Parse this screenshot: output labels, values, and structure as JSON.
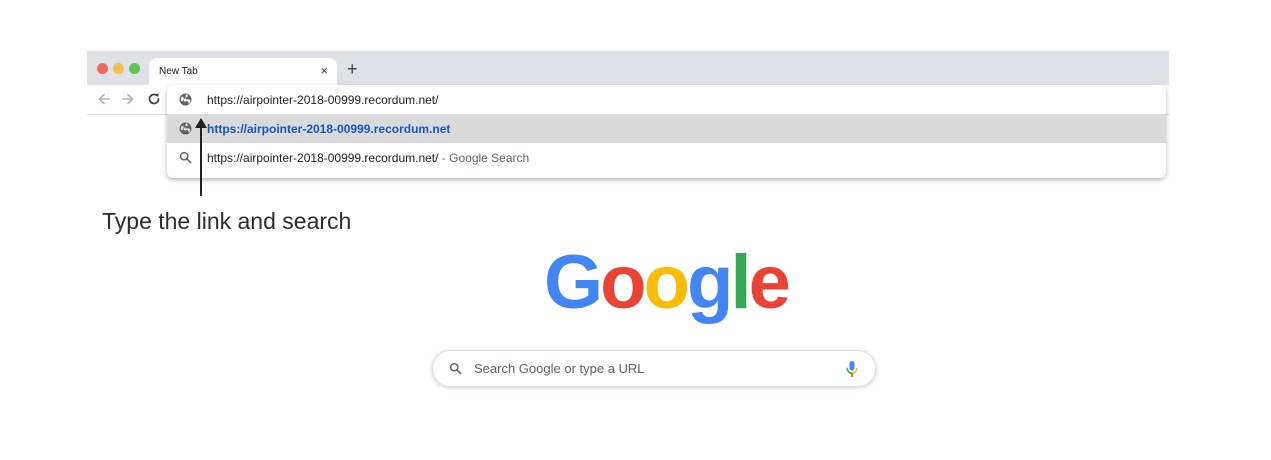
{
  "browser": {
    "tab": {
      "title": "New Tab",
      "close_glyph": "×"
    },
    "new_tab_glyph": "+",
    "nav_icons": [
      "back-arrow-icon",
      "forward-arrow-icon",
      "reload-icon"
    ]
  },
  "omnibox": {
    "value": "https://airpointer-2018-00999.recordum.net/",
    "icon": "globe-icon",
    "suggestions": [
      {
        "icon": "globe-icon",
        "text": "https://airpointer-2018-00999.recordum.net",
        "suffix": "",
        "highlighted": true
      },
      {
        "icon": "search-icon",
        "text": "https://airpointer-2018-00999.recordum.net/",
        "suffix": " - Google Search",
        "highlighted": false
      }
    ]
  },
  "annotation": {
    "text": "Type the link and search"
  },
  "new_tab_page": {
    "logo_letters": [
      "G",
      "o",
      "o",
      "g",
      "l",
      "e"
    ],
    "search_placeholder": "Search Google or type a URL"
  },
  "colors": {
    "google_blue": "#4285f4",
    "google_red": "#ea4335",
    "google_yellow": "#fbbc05",
    "google_green": "#34a853",
    "link_blue": "#1a55c4",
    "highlight_row": "#dadada"
  }
}
